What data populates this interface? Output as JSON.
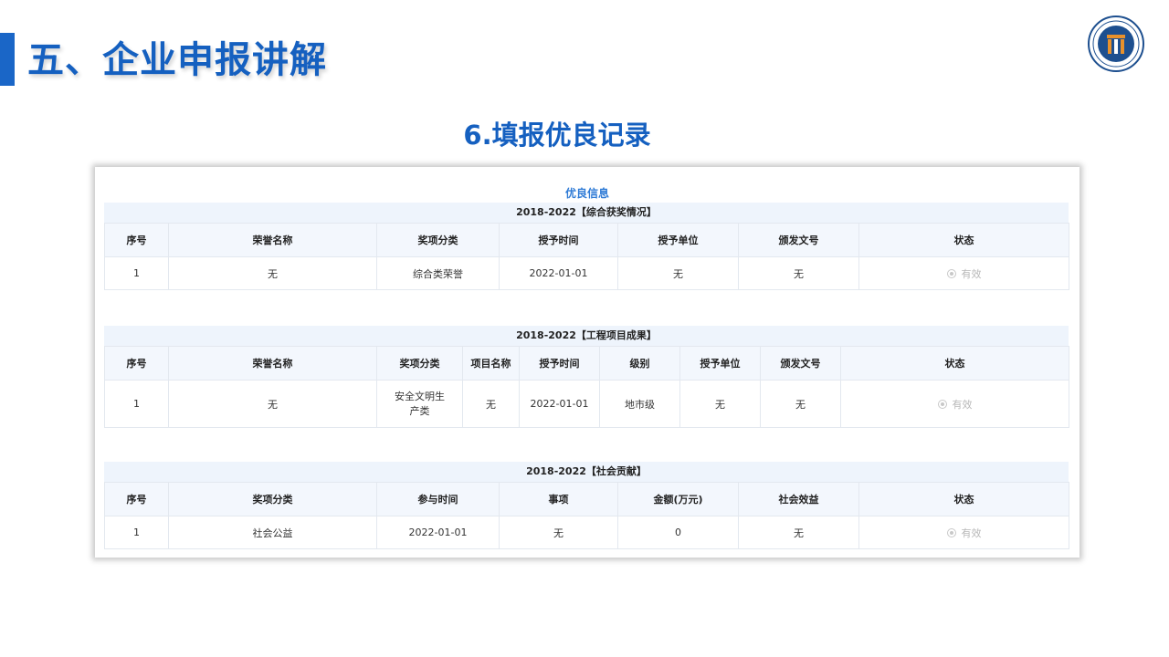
{
  "page": {
    "title": "五、企业申报讲解",
    "subtitle": "6.填报优良记录"
  },
  "panel": {
    "heading": "优良信息"
  },
  "section1": {
    "title": "2018-2022【综合获奖情况】",
    "headers": [
      "序号",
      "荣誉名称",
      "奖项分类",
      "授予时间",
      "授予单位",
      "颁发文号",
      "状态"
    ],
    "row": [
      "1",
      "无",
      "综合类荣誉",
      "2022-01-01",
      "无",
      "无"
    ],
    "status": "有效"
  },
  "section2": {
    "title": "2018-2022【工程项目成果】",
    "headers": [
      "序号",
      "荣誉名称",
      "奖项分类",
      "项目名称",
      "授予时间",
      "级别",
      "授予单位",
      "颁发文号",
      "状态"
    ],
    "row": [
      "1",
      "无",
      "安全文明生产类",
      "无",
      "2022-01-01",
      "地市级",
      "无",
      "无"
    ],
    "status": "有效"
  },
  "section3": {
    "title": "2018-2022【社会贡献】",
    "headers": [
      "序号",
      "奖项分类",
      "参与时间",
      "事项",
      "金额(万元)",
      "社会效益",
      "状态"
    ],
    "row": [
      "1",
      "社会公益",
      "2022-01-01",
      "无",
      "0",
      "无"
    ],
    "status": "有效"
  },
  "colors": {
    "accent": "#1560c0",
    "link": "#2f7bd6",
    "header_bg": "#eef4fc",
    "logo_orange": "#e8912c"
  },
  "icons": {
    "logo": "institution-logo-icon",
    "status": "radio-icon"
  }
}
